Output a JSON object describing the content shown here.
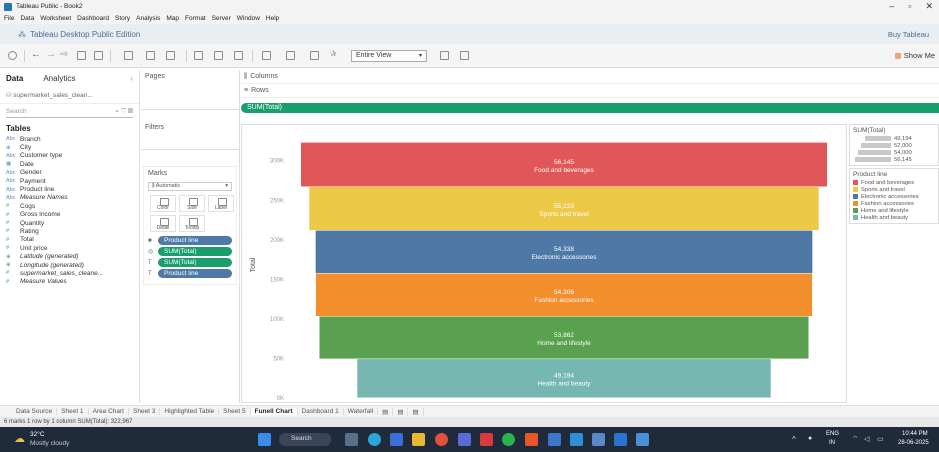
{
  "window": {
    "title": "Tableau Public - Book2"
  },
  "menu": [
    "File",
    "Data",
    "Worksheet",
    "Dashboard",
    "Story",
    "Analysis",
    "Map",
    "Format",
    "Server",
    "Window",
    "Help"
  ],
  "edition": {
    "label": "Tableau Desktop Public Edition",
    "buy": "Buy Tableau"
  },
  "toolbar": {
    "view_select": "Entire View",
    "show_me": "Show Me"
  },
  "data_pane": {
    "tab_data": "Data",
    "tab_analytics": "Analytics",
    "datasource": "supermarket_sales_clean...",
    "search_placeholder": "Search",
    "tables_heading": "Tables",
    "fields": [
      {
        "icon": "Abc",
        "kind": "dim",
        "name": "Branch",
        "italic": false
      },
      {
        "icon": "⊕",
        "kind": "dim",
        "name": "City",
        "italic": false
      },
      {
        "icon": "Abc",
        "kind": "dim",
        "name": "Customer type",
        "italic": false
      },
      {
        "icon": "▦",
        "kind": "dim",
        "name": "Date",
        "italic": false
      },
      {
        "icon": "Abc",
        "kind": "dim",
        "name": "Gender",
        "italic": false
      },
      {
        "icon": "Abc",
        "kind": "dim",
        "name": "Payment",
        "italic": false
      },
      {
        "icon": "Abc",
        "kind": "dim",
        "name": "Product line",
        "italic": false
      },
      {
        "icon": "Abc",
        "kind": "dim",
        "name": "Measure Names",
        "italic": true
      },
      {
        "icon": "#",
        "kind": "mea",
        "name": "Cogs",
        "italic": false
      },
      {
        "icon": "#",
        "kind": "mea",
        "name": "Gross Income",
        "italic": false
      },
      {
        "icon": "#",
        "kind": "mea",
        "name": "Quantity",
        "italic": false
      },
      {
        "icon": "#",
        "kind": "mea",
        "name": "Rating",
        "italic": false
      },
      {
        "icon": "#",
        "kind": "mea",
        "name": "Total",
        "italic": false
      },
      {
        "icon": "#",
        "kind": "mea",
        "name": "Unit price",
        "italic": false
      },
      {
        "icon": "⊕",
        "kind": "mea",
        "name": "Latitude (generated)",
        "italic": true
      },
      {
        "icon": "⊕",
        "kind": "mea",
        "name": "Longitude (generated)",
        "italic": true
      },
      {
        "icon": "#",
        "kind": "mea",
        "name": "supermarket_sales_cleane...",
        "italic": true
      },
      {
        "icon": "#",
        "kind": "mea",
        "name": "Measure Values",
        "italic": true
      }
    ]
  },
  "cards": {
    "pages": "Pages",
    "filters": "Filters",
    "marks": "Marks",
    "marks_type": "Automatic",
    "mark_buttons": [
      "Color",
      "Size",
      "Label",
      "Detail",
      "Tooltip"
    ],
    "pills": [
      {
        "icon": "■",
        "label": "Product line",
        "color": "blue"
      },
      {
        "icon": "◎",
        "label": "SUM(Total)",
        "color": "green"
      },
      {
        "icon": "T",
        "label": "SUM(Total)",
        "color": "green"
      },
      {
        "icon": "T",
        "label": "Product line",
        "color": "blue"
      }
    ]
  },
  "shelves": {
    "columns": "Columns",
    "rows": "Rows",
    "filter_pill": "SUM(Total)"
  },
  "chart_data": {
    "type": "bar",
    "orientation": "horizontal funnel",
    "ylabel": "Total",
    "yticks": [
      "0K",
      "50K",
      "100K",
      "150K",
      "200K",
      "250K",
      "300K"
    ],
    "ylim": [
      0,
      330000
    ],
    "categories": [
      "Food and beverages",
      "Sports and travel",
      "Electronic accessories",
      "Fashion accessories",
      "Home and lifestyle",
      "Health and beauty"
    ],
    "values": [
      56145,
      55123,
      54338,
      54306,
      53862,
      49194
    ],
    "labels": [
      "56,145",
      "55,123",
      "54,338",
      "54,306",
      "53,862",
      "49,194"
    ],
    "colors": [
      "#e15759",
      "#edc948",
      "#4e79a7",
      "#f28e2b",
      "#59a14f",
      "#76b7b2"
    ]
  },
  "legends": {
    "size_title": "SUM(Total)",
    "size_entries": [
      "49,194",
      "52,000",
      "54,000",
      "56,145"
    ],
    "color_title": "Product line",
    "color_entries": [
      {
        "name": "Food and beverages",
        "color": "#e15759"
      },
      {
        "name": "Sports and travel",
        "color": "#edc948"
      },
      {
        "name": "Electronic accessories",
        "color": "#4e79a7"
      },
      {
        "name": "Fashion accessories",
        "color": "#f28e2b"
      },
      {
        "name": "Home and lifestyle",
        "color": "#59a14f"
      },
      {
        "name": "Health and beauty",
        "color": "#76b7b2"
      }
    ]
  },
  "sheet_tabs": [
    "Data Source",
    "Sheet 1",
    "Area Chart",
    "Sheet 3",
    "Highlighted Table",
    "Sheet 5",
    "Funell Chart",
    "Dashboard 1",
    "Waterfall"
  ],
  "active_tab": "Funell Chart",
  "status": "6 marks   1 row by 1 column   SUM(Total): 322,967",
  "taskbar": {
    "weather_temp": "32°C",
    "weather_desc": "Mostly cloudy",
    "search": "Search",
    "lang": "ENG",
    "region": "IN",
    "time": "10:44 PM",
    "date": "28-06-2025"
  }
}
